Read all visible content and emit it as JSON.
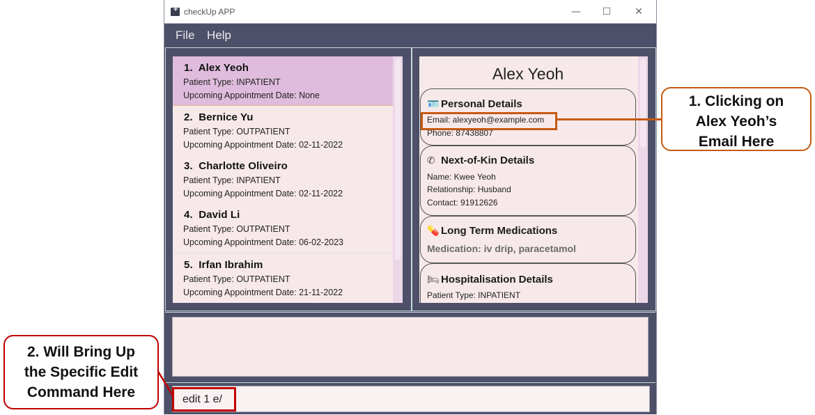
{
  "window": {
    "title": "checkUp APP",
    "controls": {
      "minimize": "—",
      "maximize": "☐",
      "close": "✕"
    }
  },
  "menu": {
    "items": [
      "File",
      "Help"
    ]
  },
  "patient_list": [
    {
      "index": "1.",
      "name": "Alex Yeoh",
      "patient_type": "Patient Type: INPATIENT",
      "appointment": "Upcoming Appointment Date: None",
      "selected": true
    },
    {
      "index": "2.",
      "name": "Bernice Yu",
      "patient_type": "Patient Type: OUTPATIENT",
      "appointment": "Upcoming Appointment Date: 02-11-2022"
    },
    {
      "index": "3.",
      "name": "Charlotte Oliveiro",
      "patient_type": "Patient Type: INPATIENT",
      "appointment": "Upcoming Appointment Date: 02-11-2022"
    },
    {
      "index": "4.",
      "name": "David Li",
      "patient_type": "Patient Type: OUTPATIENT",
      "appointment": "Upcoming Appointment Date: 06-02-2023"
    },
    {
      "index": "5.",
      "name": "Irfan Ibrahim",
      "patient_type": "Patient Type: OUTPATIENT",
      "appointment": "Upcoming Appointment Date: 21-11-2022"
    }
  ],
  "detail": {
    "name": "Alex Yeoh",
    "personal": {
      "title": "Personal Details",
      "icon": "id-badge-icon",
      "email": "Email: alexyeoh@example.com",
      "phone": "Phone: 87438807"
    },
    "next_of_kin": {
      "title": "Next-of-Kin Details",
      "icon": "phone-contact-icon",
      "name": "Name: Kwee Yeoh",
      "relationship": "Relationship: Husband",
      "contact": "Contact: 91912626"
    },
    "medications": {
      "title": "Long Term Medications",
      "icon": "pills-icon",
      "medication": "Medication: iv drip, paracetamol"
    },
    "hospitalisation": {
      "title": "Hospitalisation Details",
      "icon": "hospital-bed-icon",
      "patient_type": "Patient Type: INPATIENT"
    }
  },
  "result_display": {
    "text": ""
  },
  "command_box": {
    "value": "edit 1 e/"
  },
  "annotations": {
    "callout1": [
      "1. Clicking on",
      "Alex Yeoh’s",
      "Email Here"
    ],
    "callout2": [
      "2. Will Bring Up",
      "the Specific Edit",
      "Command Here"
    ],
    "colors": {
      "callout1": "#c55a11",
      "callout2": "#c00000"
    }
  }
}
